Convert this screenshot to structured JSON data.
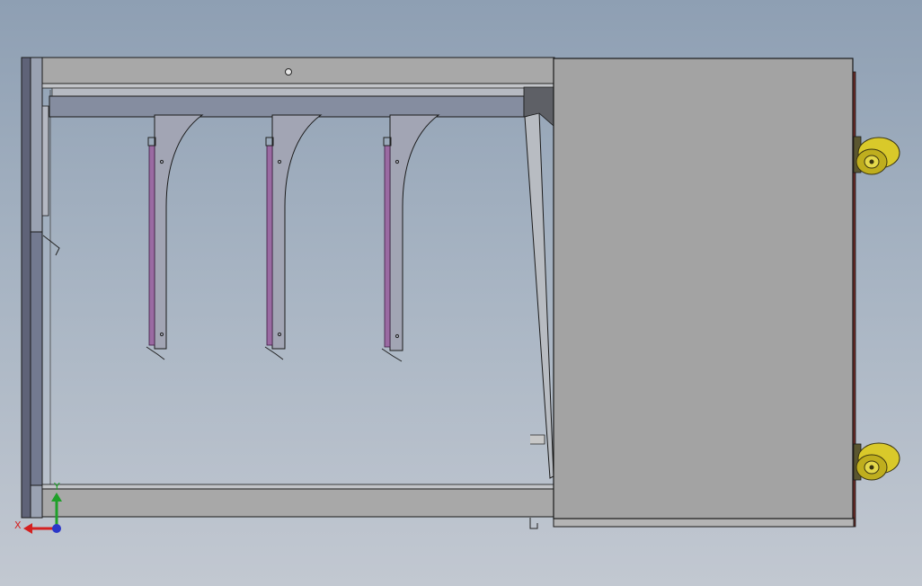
{
  "view": {
    "colors": {
      "background_top": "#8e9fb3",
      "background_bottom": "#c2c8d1",
      "cabinet_gray": "#a3a3a3",
      "rail_blue": "#868ea0",
      "slot_purple": "#9a6aa2",
      "caster_yellow": "#d9c92a",
      "axis_x": "#d42020",
      "axis_y": "#1fa02a",
      "axis_z": "#2a36c8"
    }
  },
  "triad": {
    "x_label": "X",
    "y_label": "Y"
  },
  "icons": {
    "brackets": "bracket-icon",
    "casters": "caster-wheel-icon",
    "triad": "axis-triad-icon"
  }
}
